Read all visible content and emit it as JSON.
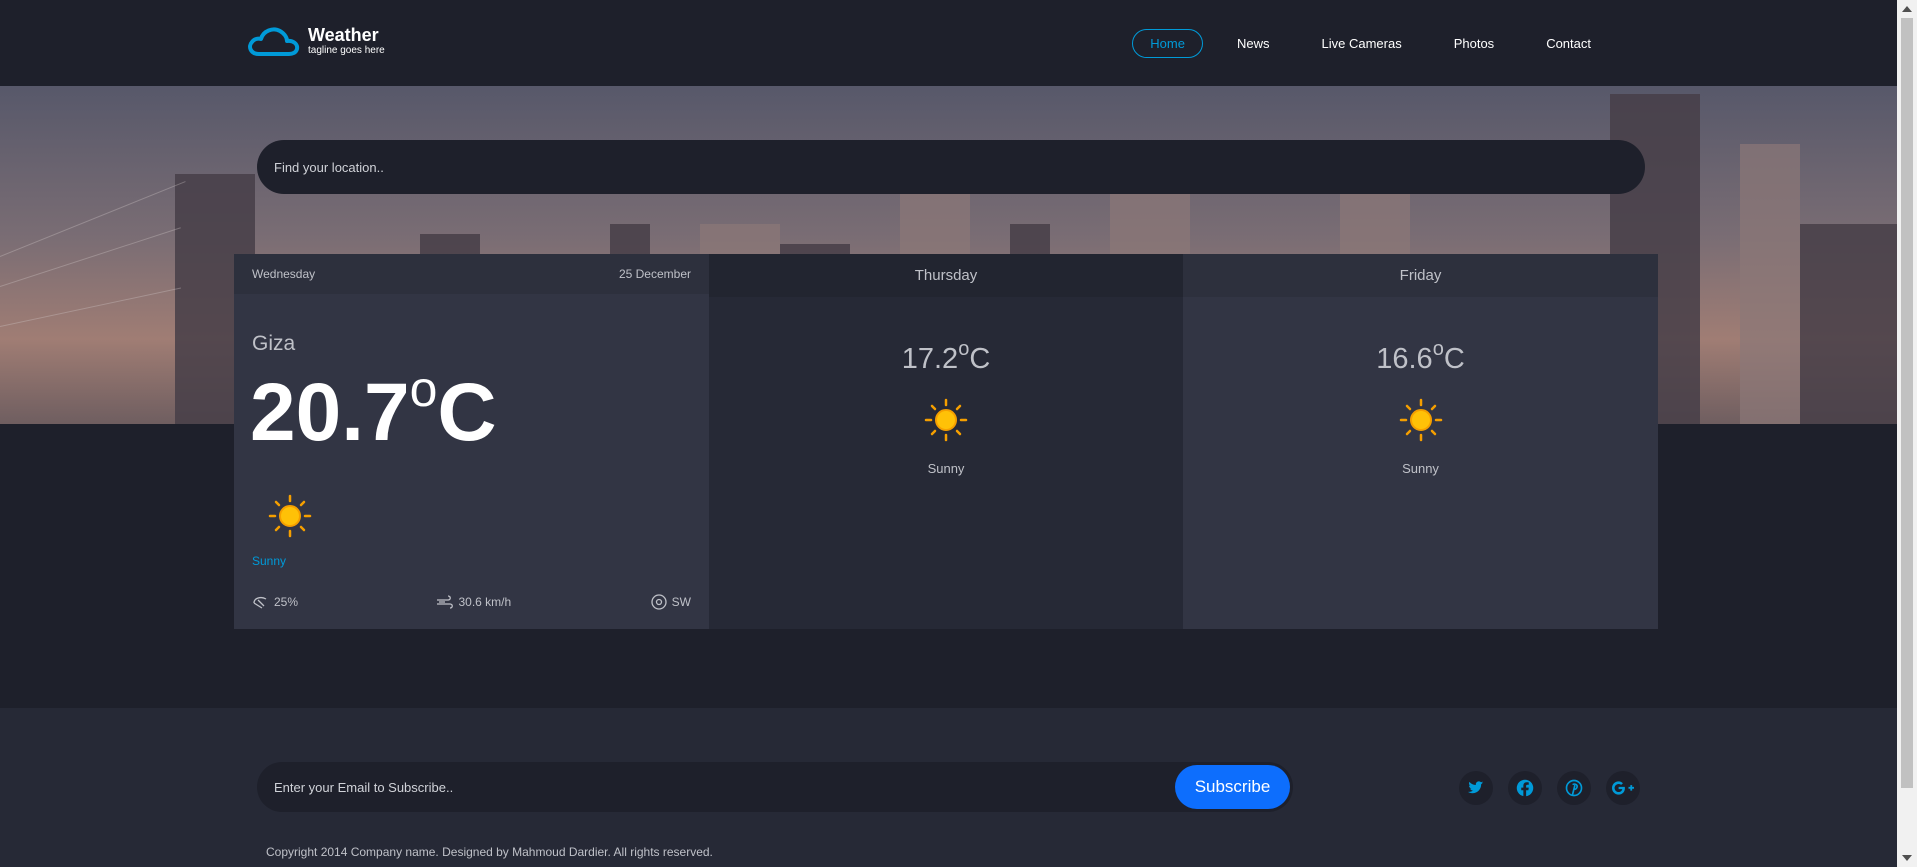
{
  "brand": {
    "title": "Weather",
    "tagline": "tagline goes here"
  },
  "nav": [
    "Home",
    "News",
    "Live Cameras",
    "Photos",
    "Contact"
  ],
  "search": {
    "placeholder": "Find your location.."
  },
  "today": {
    "day": "Wednesday",
    "date": "25 December",
    "city": "Giza",
    "temp": "20.7",
    "degree": "o",
    "unit": "C",
    "condition": "Sunny",
    "humidity": "25%",
    "wind_speed": "30.6 km/h",
    "wind_dir": "SW"
  },
  "forecast": [
    {
      "day": "Thursday",
      "temp": "17.2",
      "degree": "o",
      "unit": "C",
      "condition": "Sunny"
    },
    {
      "day": "Friday",
      "temp": "16.6",
      "degree": "o",
      "unit": "C",
      "condition": "Sunny"
    }
  ],
  "footer": {
    "email_placeholder": "Enter your Email to Subscribe..",
    "subscribe_label": "Subscribe",
    "copyright": "Copyright 2014 Company name. Designed by Mahmoud Dardier. All rights reserved.",
    "socials": [
      "twitter-icon",
      "facebook-icon",
      "pinterest-icon",
      "google-plus-icon"
    ]
  },
  "colors": {
    "accent": "#009ad8",
    "button": "#0d6efd",
    "bg": "#1e202b",
    "card": "#323544"
  }
}
